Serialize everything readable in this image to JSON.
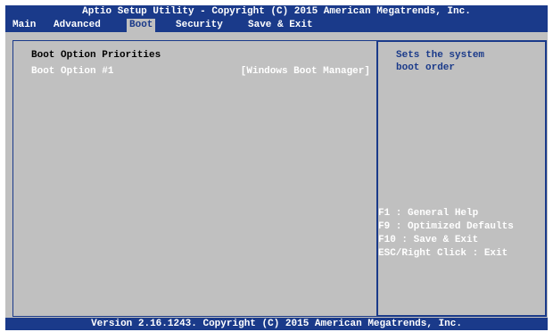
{
  "title": "Aptio Setup Utility - Copyright (C) 2015 American Megatrends, Inc.",
  "tabs": [
    {
      "label": "Main"
    },
    {
      "label": "Advanced"
    },
    {
      "label": "Boot"
    },
    {
      "label": "Security"
    },
    {
      "label": "Save & Exit"
    }
  ],
  "main": {
    "section_title": "Boot Option Priorities",
    "options": [
      {
        "label": "Boot Option #1",
        "value": "[Windows Boot Manager]"
      }
    ]
  },
  "help": {
    "description_line1": "Sets the system",
    "description_line2": "boot order",
    "keys": [
      "F1   : General Help",
      "F9   : Optimized Defaults",
      "F10  : Save & Exit",
      "ESC/Right Click  : Exit"
    ]
  },
  "footer": "Version 2.16.1243. Copyright (C) 2015 American Megatrends, Inc.",
  "colors": {
    "accent": "#1a3a8a",
    "panel": "#c0c0c0",
    "text_highlight": "#ffffff"
  }
}
